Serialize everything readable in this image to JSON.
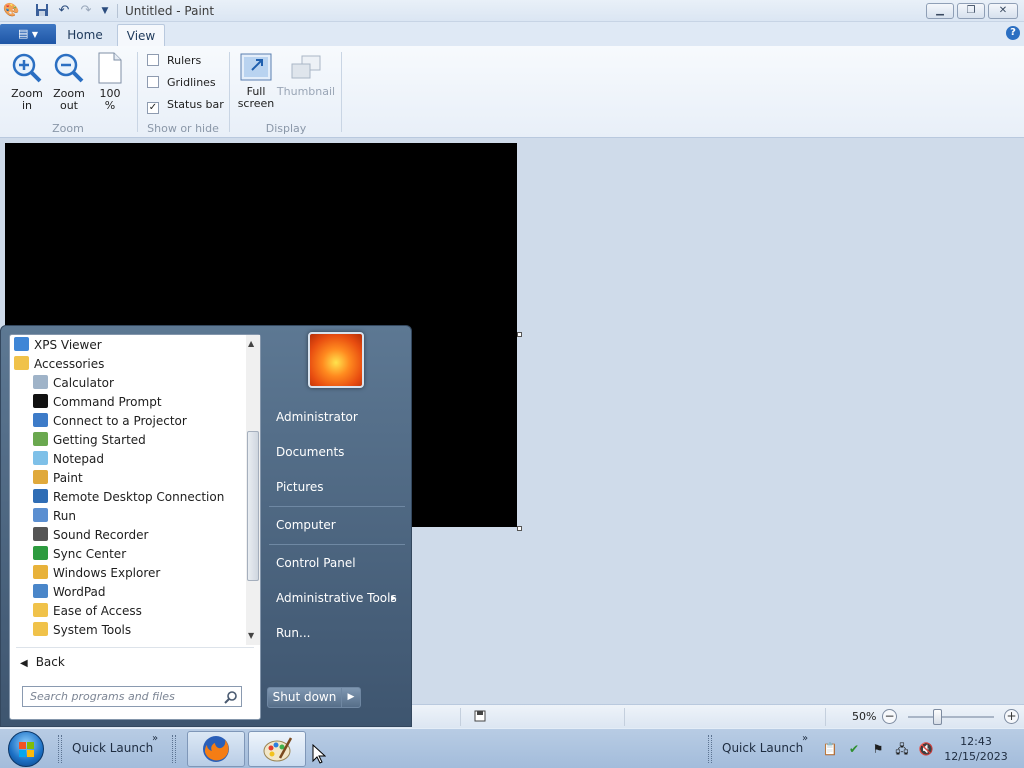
{
  "window": {
    "title": "Untitled - Paint",
    "minimize_icon": "minimize-icon",
    "maximize_icon": "restore-icon",
    "close_icon": "close-icon"
  },
  "tabs": [
    {
      "label": "Home"
    },
    {
      "label": "View",
      "selected": true
    }
  ],
  "ribbon": {
    "zoom_in": "Zoom\nin",
    "zoom_out": "Zoom\nout",
    "zoom_100": "100\n%",
    "group_zoom": "Zoom",
    "rulers": "Rulers",
    "gridlines": "Gridlines",
    "status_bar": "Status bar",
    "status_bar_checked": true,
    "group_show_hide": "Show or hide",
    "full_screen": "Full\nscreen",
    "thumbnail": "Thumbnail",
    "group_display": "Display"
  },
  "statusbar": {
    "zoom_percent": "50%",
    "zoom_level": 0.5
  },
  "start_menu": {
    "programs": [
      {
        "label": "XPS Viewer",
        "icon": "xps-viewer-icon",
        "indent": 0
      },
      {
        "label": "Accessories",
        "icon": "folder-icon",
        "indent": 0
      },
      {
        "label": "Calculator",
        "icon": "calculator-icon",
        "indent": 1
      },
      {
        "label": "Command Prompt",
        "icon": "command-prompt-icon",
        "indent": 1
      },
      {
        "label": "Connect to a Projector",
        "icon": "projector-icon",
        "indent": 1
      },
      {
        "label": "Getting Started",
        "icon": "getting-started-icon",
        "indent": 1
      },
      {
        "label": "Notepad",
        "icon": "notepad-icon",
        "indent": 1
      },
      {
        "label": "Paint",
        "icon": "paint-icon",
        "indent": 1
      },
      {
        "label": "Remote Desktop Connection",
        "icon": "remote-desktop-icon",
        "indent": 1
      },
      {
        "label": "Run",
        "icon": "run-icon",
        "indent": 1
      },
      {
        "label": "Sound Recorder",
        "icon": "microphone-icon",
        "indent": 1
      },
      {
        "label": "Sync Center",
        "icon": "sync-center-icon",
        "indent": 1
      },
      {
        "label": "Windows Explorer",
        "icon": "windows-explorer-icon",
        "indent": 1
      },
      {
        "label": "WordPad",
        "icon": "wordpad-icon",
        "indent": 1
      },
      {
        "label": "Ease of Access",
        "icon": "folder-icon",
        "indent": 1
      },
      {
        "label": "System Tools",
        "icon": "folder-icon",
        "indent": 1
      }
    ],
    "back": "Back",
    "search_placeholder": "Search programs and files",
    "right_items": [
      {
        "label": "Administrator"
      },
      {
        "label": "Documents"
      },
      {
        "label": "Pictures"
      },
      {
        "label": "Computer"
      },
      {
        "label": "Control Panel"
      },
      {
        "label": "Administrative Tools",
        "has_submenu": true
      },
      {
        "label": "Run..."
      }
    ],
    "shutdown": "Shut down"
  },
  "taskbar": {
    "quick_launch_left": "Quick Launch",
    "quick_launch_right": "Quick Launch",
    "chevron": "»",
    "clock_time": "12:43",
    "clock_date": "12/15/2023",
    "apps": [
      {
        "name": "Firefox",
        "icon": "firefox-icon"
      },
      {
        "name": "Paint",
        "icon": "paint-icon"
      }
    ]
  }
}
